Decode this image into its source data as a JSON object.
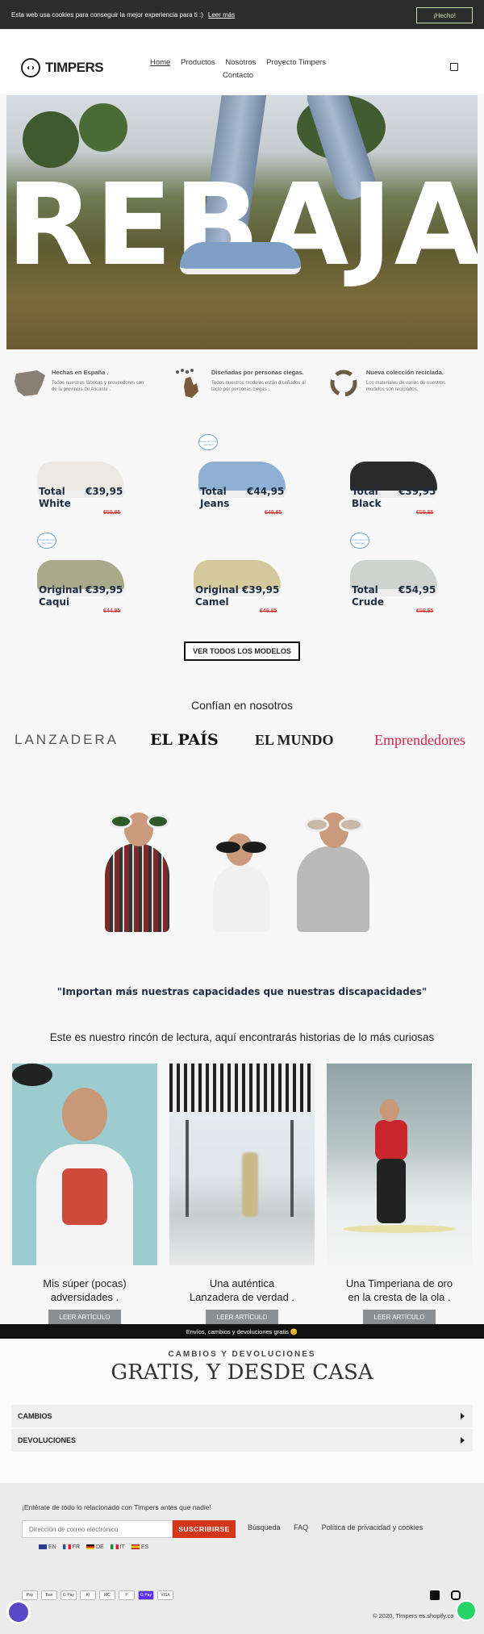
{
  "cookie_bar": {
    "text": "Esta web usa cookies para conseguir la mejor experiencia para ti :)",
    "link": "Leer más",
    "accept": "¡Hecho!"
  },
  "header": {
    "logo": "TIMPERS",
    "nav": [
      {
        "label": "Home",
        "active": true
      },
      {
        "label": "Productos",
        "active": false
      },
      {
        "label": "Nosotros",
        "active": false
      },
      {
        "label": "Proyecto Timpers",
        "active": false
      },
      {
        "label": "Contacto",
        "active": false
      }
    ],
    "cart_icon": "shopping-bag-icon"
  },
  "hero": {
    "headline": "REBAJAS"
  },
  "features": [
    {
      "icon": "spain-map-icon",
      "title": "Hechas en España .",
      "text": "Todos nuestras fábricas y proveedores son de la provincia de Alicante ."
    },
    {
      "icon": "braille-hand-icon",
      "title": "Diseñadas por personas ciegas.",
      "text": "Todos nuestros modelos están diseñados al tacto por personas ciegas ."
    },
    {
      "icon": "recycle-icon",
      "title": "Nueva colección reciclada.",
      "text": "Los materiales de varios de nuestros modelos son reciclados."
    }
  ],
  "products": [
    {
      "name1": "Total",
      "name2": "White",
      "price": "€39,95",
      "old_price": "€59,95",
      "color": "#ece9e2",
      "badge": false
    },
    {
      "name1": "Total",
      "name2": "Jeans",
      "price": "€44,95",
      "old_price": "€49,95",
      "color": "#8fb0d3",
      "badge": true
    },
    {
      "name1": "Total",
      "name2": "Black",
      "price": "€39,95",
      "old_price": "€59,95",
      "color": "#2a2a2a",
      "badge": false
    },
    {
      "name1": "Original",
      "name2": "Caqui",
      "price": "€39,95",
      "old_price": "€44,95",
      "color": "#a9a98c",
      "badge": true
    },
    {
      "name1": "Original",
      "name2": "Camel",
      "price": "€39,95",
      "old_price": "€49,95",
      "color": "#d5c89d",
      "badge": false
    },
    {
      "name1": "Total",
      "name2": "Crude",
      "price": "€54,95",
      "old_price": "€59,95",
      "color": "#cfd3d0",
      "badge": true
    }
  ],
  "badge_text": "Global Recycled Standard",
  "cta": {
    "ver_todos": "VER TODOS LOS MODELOS"
  },
  "press": {
    "heading": "Confían en nosotros",
    "logos": [
      "LANZADERA",
      "EL PAÍS",
      "EL MUNDO",
      "Emprendedores"
    ]
  },
  "quote": "\"Importan más nuestras capacidades que nuestras discapacidades\"",
  "blog": {
    "heading": "Este es nuestro rincón de lectura, aquí encontrarás historias de lo más curiosas",
    "button": "LEER ARTÍCULO",
    "articles": [
      {
        "line1": "Mis súper (pocas)",
        "line2": "adversidades ."
      },
      {
        "line1": "Una auténtica",
        "line2": "Lanzadera de verdad ."
      },
      {
        "line1": "Una Timperiana de oro",
        "line2": "en la cresta de la ola ."
      }
    ]
  },
  "shipping_bar": "Envíos, cambios y devoluciones gratis 😊",
  "returns": {
    "subtitle": "CAMBIOS Y DEVOLUCIONES",
    "title": "GRATIS, Y DESDE CASA",
    "items": [
      "CAMBIOS",
      "DEVOLUCIONES"
    ]
  },
  "footer": {
    "newsletter_heading": "¡Entérate de todo lo relacionado con Timpers antes que nadie!",
    "email_placeholder": "Dirección de correo electrónico",
    "subscribe": "SUSCRIBIRSE",
    "links": [
      "Búsqueda",
      "FAQ",
      "Política de privacidad y cookies"
    ],
    "languages": [
      "EN",
      "FR",
      "DE",
      "IT",
      "ES"
    ],
    "payments": [
      "Pay",
      "Ban",
      "G Pay",
      "Kl",
      "MC",
      "P",
      "G Pay",
      "VISA"
    ],
    "copyright": "© 2020, Timpers es.shopify.co"
  }
}
